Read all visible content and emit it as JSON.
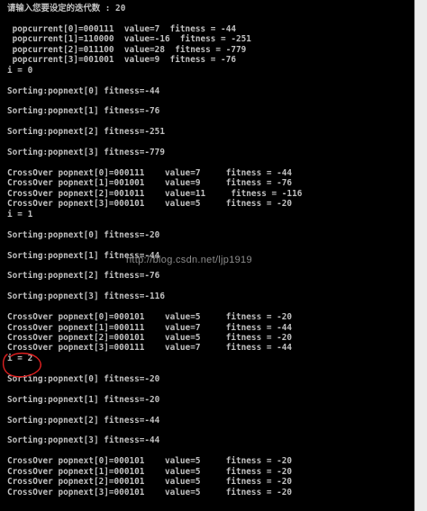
{
  "console": {
    "lines": [
      "请输入您要设定的迭代数 : 20",
      "",
      " popcurrent[0]=000111  value=7  fitness = -44",
      " popcurrent[1]=110000  value=-16  fitness = -251",
      " popcurrent[2]=011100  value=28  fitness = -779",
      " popcurrent[3]=001001  value=9  fitness = -76",
      "i = 0",
      "",
      "Sorting:popnext[0] fitness=-44",
      "",
      "Sorting:popnext[1] fitness=-76",
      "",
      "Sorting:popnext[2] fitness=-251",
      "",
      "Sorting:popnext[3] fitness=-779",
      "",
      "CrossOver popnext[0]=000111    value=7     fitness = -44",
      "CrossOver popnext[1]=001001    value=9     fitness = -76",
      "CrossOver popnext[2]=001011    value=11     fitness = -116",
      "CrossOver popnext[3]=000101    value=5     fitness = -20",
      "i = 1",
      "",
      "Sorting:popnext[0] fitness=-20",
      "",
      "Sorting:popnext[1] fitness=-44",
      "",
      "Sorting:popnext[2] fitness=-76",
      "",
      "Sorting:popnext[3] fitness=-116",
      "",
      "CrossOver popnext[0]=000101    value=5     fitness = -20",
      "CrossOver popnext[1]=000111    value=7     fitness = -44",
      "CrossOver popnext[2]=000101    value=5     fitness = -20",
      "CrossOver popnext[3]=000111    value=7     fitness = -44",
      "i = 2",
      "",
      "Sorting:popnext[0] fitness=-20",
      "",
      "Sorting:popnext[1] fitness=-20",
      "",
      "Sorting:popnext[2] fitness=-44",
      "",
      "Sorting:popnext[3] fitness=-44",
      "",
      "CrossOver popnext[0]=000101    value=5     fitness = -20",
      "CrossOver popnext[1]=000101    value=5     fitness = -20",
      "CrossOver popnext[2]=000101    value=5     fitness = -20",
      "CrossOver popnext[3]=000101    value=5     fitness = -20"
    ]
  },
  "watermark": {
    "text": "http://blog.csdn.net/ljp1919"
  },
  "colors": {
    "console_bg": "#000000",
    "console_text": "#c0c0c0",
    "annotation": "#e02020",
    "scrollbar_bg": "#ececec"
  }
}
